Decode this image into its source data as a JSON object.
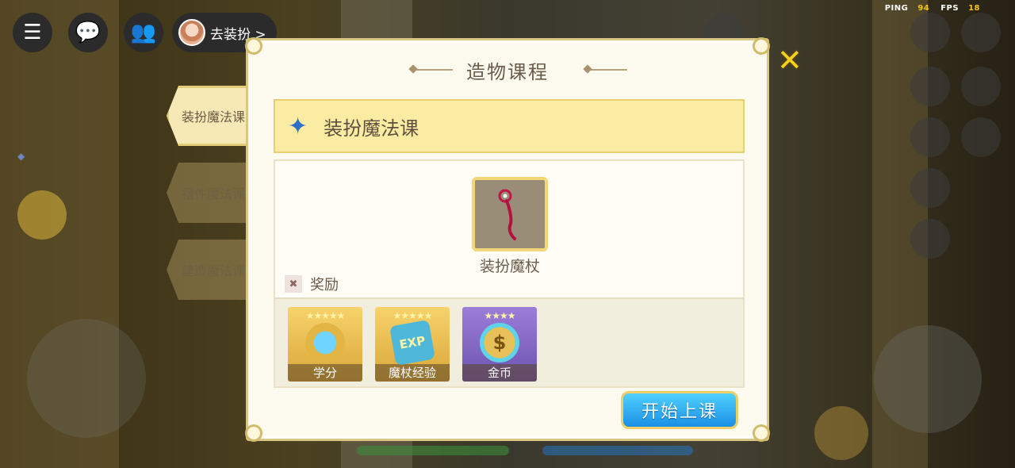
{
  "hud": {
    "dressup_label": "去装扮 >",
    "ping_label": "PING",
    "ping_value": "94",
    "fps_label": "FPS",
    "fps_value": "18"
  },
  "tabs": [
    {
      "label": "装扮魔法课",
      "active": true
    },
    {
      "label": "摆件魔法课",
      "active": false
    },
    {
      "label": "建造魔法课",
      "active": false
    }
  ],
  "panel": {
    "title": "造物课程",
    "course_title": "装扮魔法课",
    "item_name": "装扮魔杖",
    "reward_heading": "奖励",
    "rewards": [
      {
        "label": "学分",
        "stars": "★★★★★"
      },
      {
        "label": "魔杖经验",
        "stars": "★★★★★"
      },
      {
        "label": "金币",
        "stars": "★★★★"
      }
    ],
    "start_button": "开始上课"
  },
  "colors": {
    "accent_yellow": "#f5d11b",
    "start_blue": "#1b8fe6",
    "panel_bg": "#fdfaef"
  }
}
